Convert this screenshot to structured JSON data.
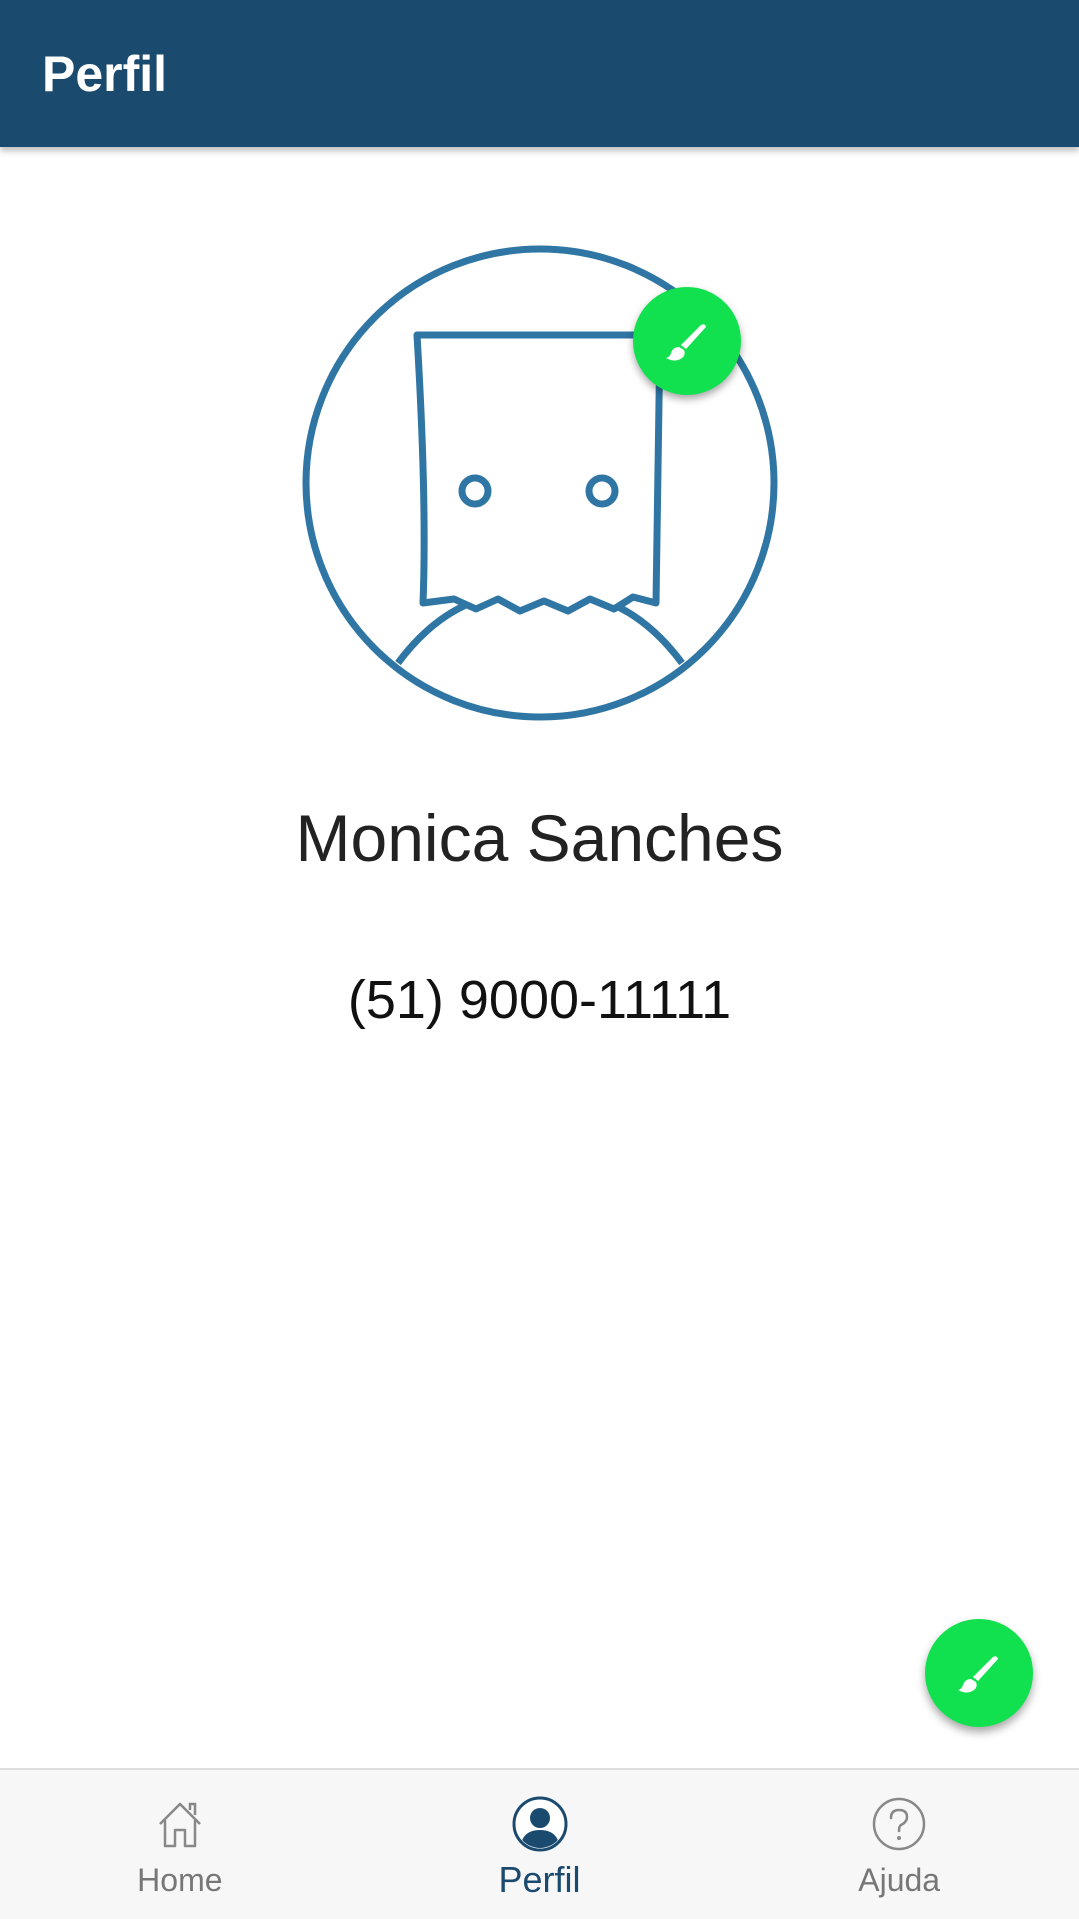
{
  "app_bar": {
    "title": "Perfil"
  },
  "profile": {
    "avatar_icon": "paper-bag-avatar-icon",
    "edit_avatar_icon": "paintbrush-icon",
    "name": "Monica Sanches",
    "phone": "(51) 9000-11111"
  },
  "fab": {
    "icon": "paintbrush-icon"
  },
  "bottom_nav": {
    "items": [
      {
        "label": "Home",
        "icon": "home-icon",
        "active": false
      },
      {
        "label": "Perfil",
        "icon": "person-icon",
        "active": true
      },
      {
        "label": "Ajuda",
        "icon": "help-icon",
        "active": false
      }
    ]
  },
  "colors": {
    "app_bar": "#1b4a6f",
    "accent": "#12e14f",
    "avatar_stroke": "#2f76a4",
    "nav_active": "#1b4a6f",
    "nav_inactive": "#777777"
  }
}
